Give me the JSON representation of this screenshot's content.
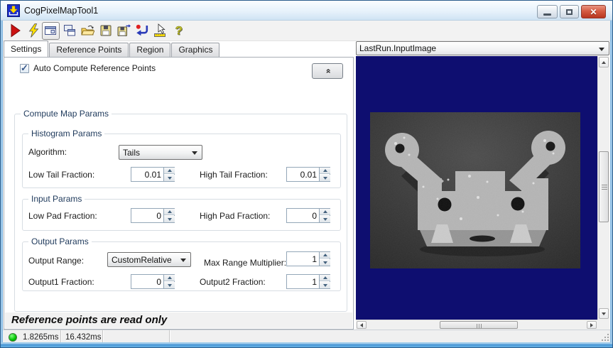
{
  "window": {
    "title": "CogPixelMapTool1"
  },
  "toolbar": {
    "buttons": [
      {
        "name": "run"
      },
      {
        "name": "electric-run"
      },
      {
        "name": "local-display",
        "pressed": true
      },
      {
        "name": "floating-display"
      },
      {
        "name": "open-file"
      },
      {
        "name": "save"
      },
      {
        "name": "save-as"
      },
      {
        "name": "reset"
      },
      {
        "name": "record-display"
      },
      {
        "name": "help"
      }
    ]
  },
  "tabs": {
    "items": [
      {
        "label": "Settings",
        "active": true
      },
      {
        "label": "Reference Points",
        "active": false
      },
      {
        "label": "Region",
        "active": false
      },
      {
        "label": "Graphics",
        "active": false
      }
    ]
  },
  "settings_tab": {
    "auto_compute": {
      "label": "Auto Compute Reference Points",
      "checked": true
    },
    "compute_map_params": {
      "title": "Compute Map Params",
      "histogram_params": {
        "title": "Histogram Params",
        "algorithm": {
          "label": "Algorithm:",
          "value": "Tails"
        },
        "low_tail_fraction": {
          "label": "Low Tail Fraction:",
          "value": "0.01"
        },
        "high_tail_fraction": {
          "label": "High Tail Fraction:",
          "value": "0.01"
        }
      },
      "input_params": {
        "title": "Input Params",
        "low_pad_fraction": {
          "label": "Low Pad Fraction:",
          "value": "0"
        },
        "high_pad_fraction": {
          "label": "High Pad Fraction:",
          "value": "0"
        }
      },
      "output_params": {
        "title": "Output Params",
        "output_range": {
          "label": "Output Range:",
          "value": "CustomRelative"
        },
        "max_range_multiplier": {
          "label": "Max Range Multiplier:",
          "value": "1"
        },
        "output1_fraction": {
          "label": "Output1 Fraction:",
          "value": "0"
        },
        "output2_fraction": {
          "label": "Output2 Fraction:",
          "value": "1"
        }
      }
    },
    "message": "Reference points are read only"
  },
  "display_panel": {
    "image_selector_value": "LastRun.InputImage"
  },
  "status_bar": {
    "run_time": "1.8265ms",
    "total_time": "16.432ms"
  },
  "icons": {
    "check_glyph": "✓",
    "collapse_glyph": "»",
    "close_glyph": "✕"
  },
  "colors": {
    "viewer_background": "#0e0e70",
    "status_indicator_green": "#00c400",
    "close_button_red": "#c83c28",
    "group_caption": "#1e395b"
  }
}
